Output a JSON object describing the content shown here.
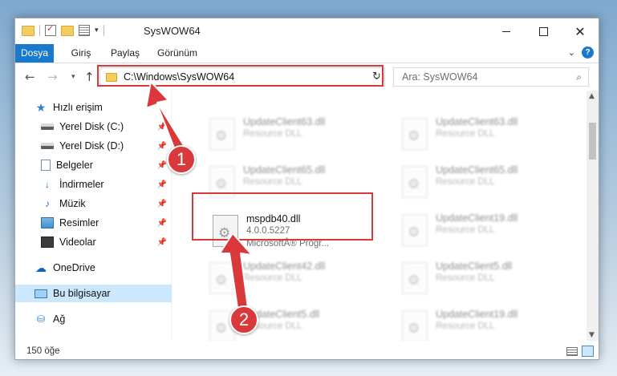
{
  "titlebar": {
    "title": "SysWOW64",
    "qat_icons": [
      "folder-icon",
      "properties-icon",
      "new-folder-icon",
      "layout-icon"
    ],
    "controls": [
      "minimize",
      "maximize",
      "close"
    ]
  },
  "ribbon": {
    "tabs": [
      "Dosya",
      "Giriş",
      "Paylaş",
      "Görünüm"
    ],
    "help_label": "?"
  },
  "navigation": {
    "back": "←",
    "forward": "→",
    "recent": "▾",
    "up": "↑",
    "address_path": "C:\\Windows\\SysWOW64",
    "address_dropdown": "⌄",
    "refresh": "↻",
    "search_placeholder": "Ara: SysWOW64",
    "search_icon": "⌕"
  },
  "sidebar": {
    "items": [
      {
        "label": "Hızlı erişim",
        "icon": "star-icon",
        "glyph": "★",
        "pinned": false
      },
      {
        "label": "Yerel Disk (C:)",
        "icon": "disk-icon",
        "glyph": "",
        "pinned": true
      },
      {
        "label": "Yerel Disk (D:)",
        "icon": "disk-icon",
        "glyph": "",
        "pinned": true
      },
      {
        "label": "Belgeler",
        "icon": "document-icon",
        "glyph": "",
        "pinned": true
      },
      {
        "label": "İndirmeler",
        "icon": "download-icon",
        "glyph": "↓",
        "pinned": true
      },
      {
        "label": "Müzik",
        "icon": "music-icon",
        "glyph": "♪",
        "pinned": true
      },
      {
        "label": "Resimler",
        "icon": "pictures-icon",
        "glyph": "",
        "pinned": true
      },
      {
        "label": "Videolar",
        "icon": "videos-icon",
        "glyph": "",
        "pinned": true
      },
      {
        "label": "OneDrive",
        "icon": "onedrive-icon",
        "glyph": "☁",
        "pinned": false
      },
      {
        "label": "Bu bilgisayar",
        "icon": "this-pc-icon",
        "glyph": "",
        "pinned": false,
        "selected": true
      },
      {
        "label": "Ağ",
        "icon": "network-icon",
        "glyph": "⛁",
        "pinned": false
      }
    ],
    "pin_glyph": "📌"
  },
  "files": [
    {
      "name": "UpdateClient63.dll",
      "line2": "Resource DLL",
      "line3": "",
      "blurred": true
    },
    {
      "name": "UpdateClient63.dll",
      "line2": "Resource DLL",
      "line3": "",
      "blurred": true
    },
    {
      "name": "UpdateClient65.dll",
      "line2": "Resource DLL",
      "line3": "",
      "blurred": true
    },
    {
      "name": "UpdateClient65.dll",
      "line2": "Resource DLL",
      "line3": "",
      "blurred": true
    },
    {
      "name": "mspdb40.dll",
      "line2": "4.0.0.5227",
      "line3": "MicrosoftÂ® Progr...",
      "blurred": false
    },
    {
      "name": "UpdateClient19.dll",
      "line2": "Resource DLL",
      "line3": "",
      "blurred": true
    },
    {
      "name": "UpdateClient42.dll",
      "line2": "Resource DLL",
      "line3": "",
      "blurred": true
    },
    {
      "name": "UpdateClient5.dll",
      "line2": "Resource DLL",
      "line3": "",
      "blurred": true
    },
    {
      "name": "UpdateClient5.dll",
      "line2": "Resource DLL",
      "line3": "",
      "blurred": true
    },
    {
      "name": "UpdateClient19.dll",
      "line2": "Resource DLL",
      "line3": "",
      "blurred": true
    }
  ],
  "status": {
    "item_count": "150 öğe"
  },
  "annotations": {
    "step1": "1",
    "step2": "2",
    "highlight_color": "#d9393b"
  },
  "colors": {
    "accent": "#1979ca",
    "selection": "#cce8ff",
    "highlight": "#d9393b"
  }
}
